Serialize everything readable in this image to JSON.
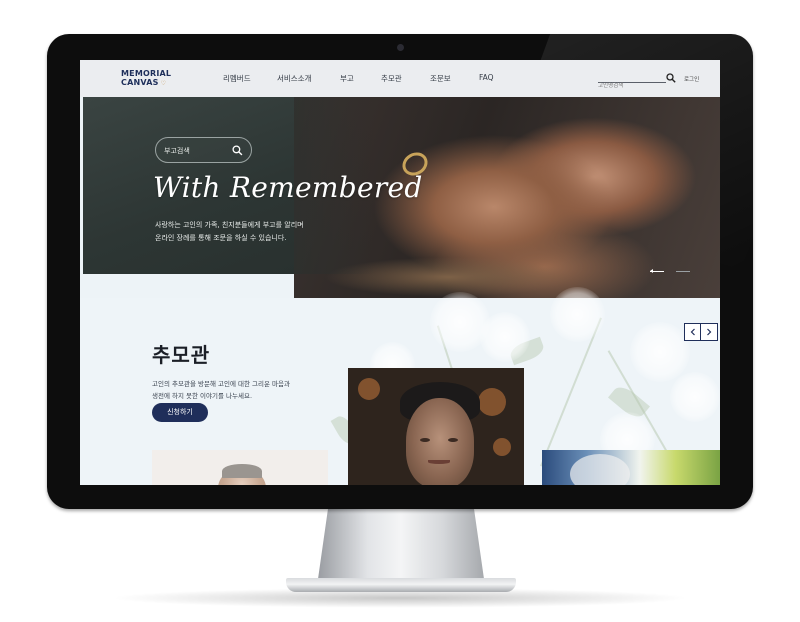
{
  "header": {
    "logo_line1": "MEMORIAL",
    "logo_line2": "CANVAS",
    "logo_mark": "♡",
    "nav": [
      {
        "label": "리멤버드"
      },
      {
        "label": "서비스소개"
      },
      {
        "label": "부고"
      },
      {
        "label": "추모관"
      },
      {
        "label": "조문보"
      },
      {
        "label": "FAQ"
      }
    ],
    "search_placeholder": "고인명검색",
    "search_icon": "search-icon",
    "login_label": "로그인"
  },
  "hero": {
    "search_placeholder": "부고검색",
    "search_icon": "search-icon",
    "title": "With Remembered",
    "desc_line1": "사랑하는 고인의 가족, 친지분들에게 부고를 알리며",
    "desc_line2": "온라인 장례를 통해 조문을 하실 수 있습니다."
  },
  "memorial": {
    "title": "추모관",
    "desc_line1": "고인의 추모관을 방문해 고인에 대한 그리운 마음과",
    "desc_line2": "생전에 하지 못한 이야기를 나누세요.",
    "apply_label": "신청하기",
    "prev_icon": "chevron-left-icon",
    "next_icon": "chevron-right-icon"
  },
  "colors": {
    "brand_navy": "#1f2e5a",
    "accent_gold": "#c6934f",
    "section_bg": "#eef4f8"
  }
}
